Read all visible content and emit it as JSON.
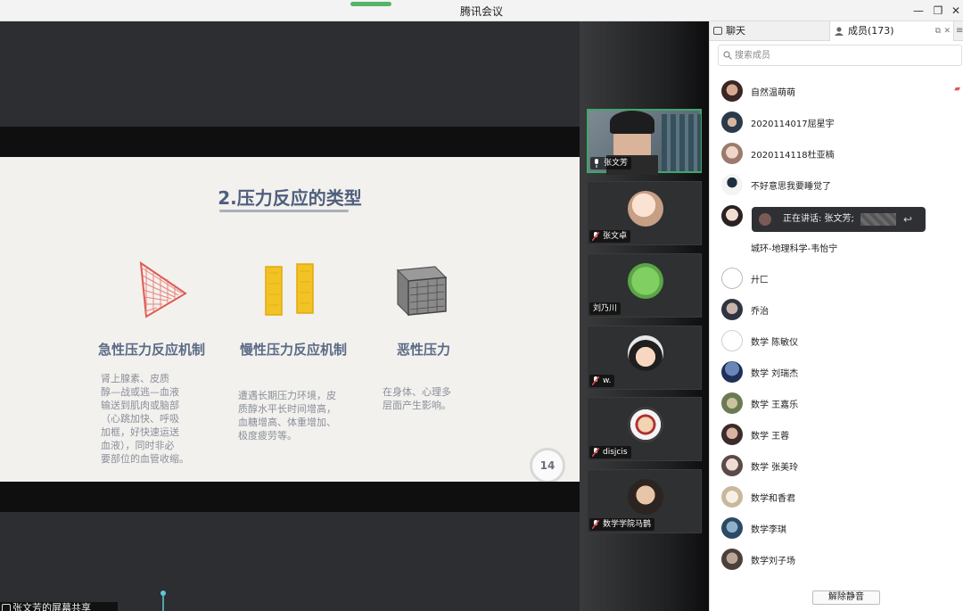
{
  "window": {
    "title": "腾讯会议"
  },
  "slide": {
    "title": "2.压力反应的类型",
    "columns": [
      {
        "heading": "急性压力反应机制",
        "lines": [
          "肾上腺素、皮质",
          "醇—战或逃—血液",
          "输送到肌肉或脑部",
          "（心跳加快、呼吸",
          "加框，好快速运送",
          "血液），同时非必",
          "要部位的血管收缩。"
        ]
      },
      {
        "heading": "慢性压力反应机制",
        "lines": [
          "遭遇长期压力环境，皮",
          "质醇水平长时间增高，",
          "血糖增高、体重增加、",
          "极度疲劳等。"
        ]
      },
      {
        "heading": "恶性压力",
        "lines": [
          "在身体、心理多",
          "层面产生影响。"
        ]
      }
    ],
    "page_number": "14"
  },
  "share_label": "张文芳的屏幕共享",
  "videos": [
    {
      "name": "张文芳",
      "active": true
    },
    {
      "name": "张文卓"
    },
    {
      "name": "刘乃川"
    },
    {
      "name": "w."
    },
    {
      "name": "disjcis"
    },
    {
      "name": "数学学院马鹊"
    }
  ],
  "panel": {
    "tab_chat": "聊天",
    "tab_members": "成员(173)",
    "search_placeholder": "搜索成员",
    "members": [
      "自然温萌萌",
      "2020114017屈星宇",
      "2020114118杜亚楠",
      "不好意思我要睡觉了",
      "",
      "城环-地理科学-韦怡宁",
      "廾匚",
      "乔治",
      "数学  陈敏仪",
      "数学 刘瑞杰",
      "数学 王嘉乐",
      "数学 王蓉",
      "数学 张美玲",
      "数学和香君",
      "数学李琪",
      "数学刘子场"
    ],
    "unmute_label": "解除静音"
  },
  "speaking_banner": "正在讲话: 张文芳;",
  "colors": {
    "accent_green": "#3fa86a",
    "slide_title": "#4e5f7d"
  }
}
